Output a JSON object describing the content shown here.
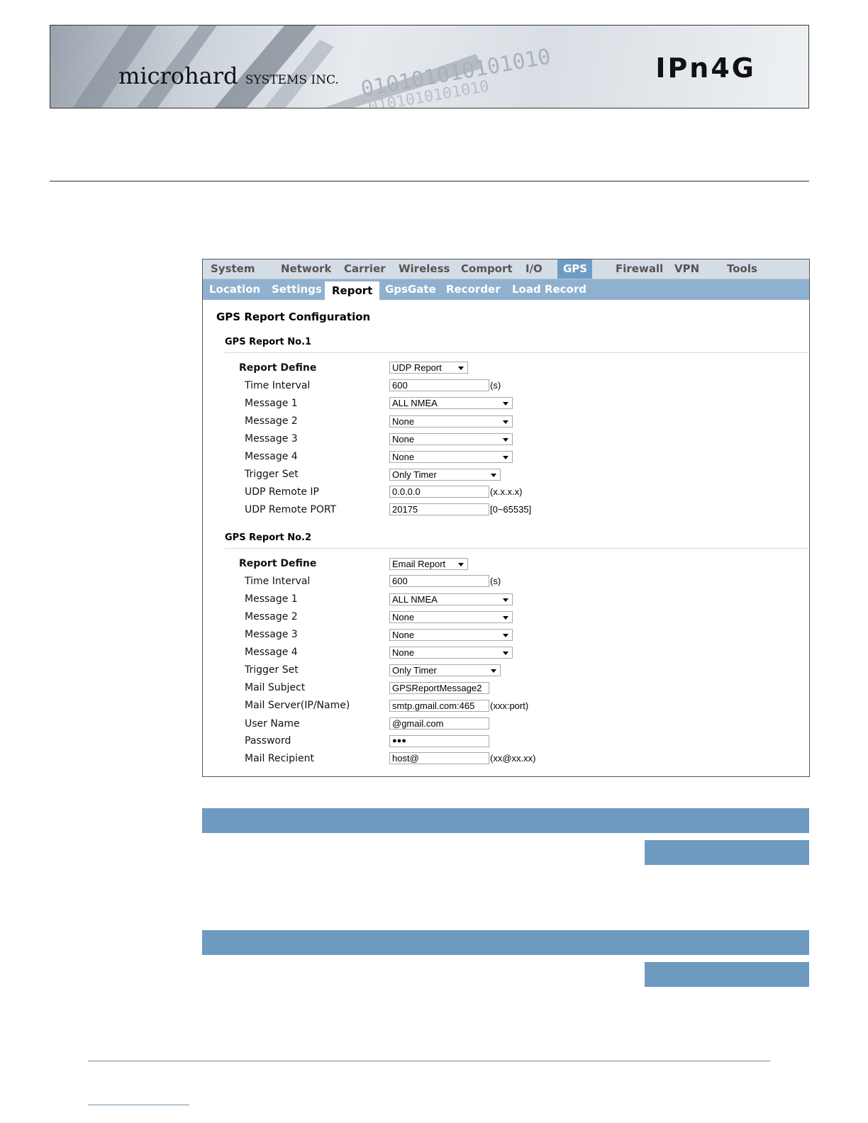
{
  "header": {
    "brand": "microhard",
    "brand_sub": "SYSTEMS INC.",
    "product": "IPn4G",
    "binary_text": "010101010101010"
  },
  "menu": {
    "main": [
      "System",
      "Network",
      "Carrier",
      "Wireless",
      "Comport",
      "I/O",
      "GPS",
      "Firewall",
      "VPN",
      "Tools"
    ],
    "main_active": "GPS",
    "sub": [
      "Location",
      "Settings",
      "Report",
      "GpsGate",
      "Recorder",
      "Load Record"
    ],
    "sub_active": "Report"
  },
  "config_title": "GPS Report Configuration",
  "report1": {
    "title": "GPS Report No.1",
    "define_label": "Report Define",
    "define_value": "UDP Report",
    "interval_label": "Time Interval",
    "interval_value": "600",
    "interval_unit": "(s)",
    "msg1_label": "Message 1",
    "msg1_value": "ALL NMEA",
    "msg2_label": "Message 2",
    "msg2_value": "None",
    "msg3_label": "Message 3",
    "msg3_value": "None",
    "msg4_label": "Message 4",
    "msg4_value": "None",
    "trigger_label": "Trigger Set",
    "trigger_value": "Only Timer",
    "ip_label": "UDP Remote IP",
    "ip_value": "0.0.0.0",
    "ip_hint": "(x.x.x.x)",
    "port_label": "UDP Remote PORT",
    "port_value": "20175",
    "port_hint": "[0~65535]"
  },
  "report2": {
    "title": "GPS Report No.2",
    "define_label": "Report Define",
    "define_value": "Email Report",
    "interval_label": "Time Interval",
    "interval_value": "600",
    "interval_unit": "(s)",
    "msg1_label": "Message 1",
    "msg1_value": "ALL NMEA",
    "msg2_label": "Message 2",
    "msg2_value": "None",
    "msg3_label": "Message 3",
    "msg3_value": "None",
    "msg4_label": "Message 4",
    "msg4_value": "None",
    "trigger_label": "Trigger Set",
    "trigger_value": "Only Timer",
    "subject_label": "Mail Subject",
    "subject_value": "GPSReportMessage2",
    "server_label": "Mail Server(IP/Name)",
    "server_value": "smtp.gmail.com:465",
    "server_hint": "(xxx:port)",
    "user_label": "User Name",
    "user_value": "@gmail.com",
    "pass_label": "Password",
    "pass_value": "●●●",
    "recip_label": "Mail Recipient",
    "recip_value": "host@",
    "recip_hint": "(xx@xx.xx)"
  }
}
